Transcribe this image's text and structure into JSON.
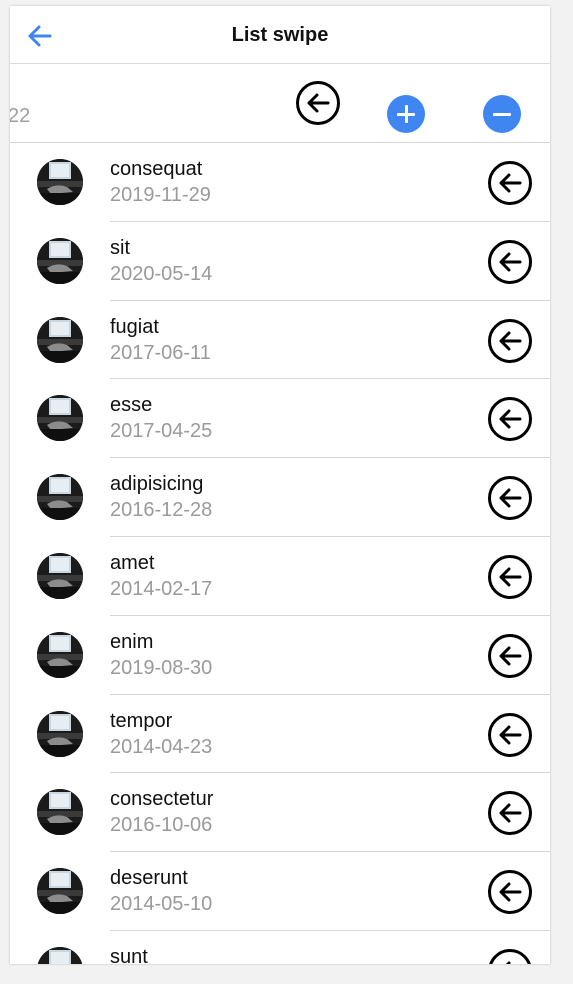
{
  "colors": {
    "accent": "#3f86f0",
    "text": "#111111",
    "secondary_text": "#9a9a9a",
    "divider": "#d6d6d6"
  },
  "navbar": {
    "title": "List swipe",
    "back_icon": "arrow-left-icon"
  },
  "swiped_item": {
    "partial_date": "22",
    "swipe_icon": "arrow-left-circle-icon",
    "actions": [
      {
        "name": "add",
        "icon": "plus-icon"
      },
      {
        "name": "remove",
        "icon": "minus-icon"
      }
    ]
  },
  "items": [
    {
      "title": "consequat",
      "date": "2019-11-29"
    },
    {
      "title": "sit",
      "date": "2020-05-14"
    },
    {
      "title": "fugiat",
      "date": "2017-06-11"
    },
    {
      "title": "esse",
      "date": "2017-04-25"
    },
    {
      "title": "adipisicing",
      "date": "2016-12-28"
    },
    {
      "title": "amet",
      "date": "2014-02-17"
    },
    {
      "title": "enim",
      "date": "2019-08-30"
    },
    {
      "title": "tempor",
      "date": "2014-04-23"
    },
    {
      "title": "consectetur",
      "date": "2016-10-06"
    },
    {
      "title": "deserunt",
      "date": "2014-05-10"
    },
    {
      "title": "sunt",
      "date": ""
    }
  ]
}
